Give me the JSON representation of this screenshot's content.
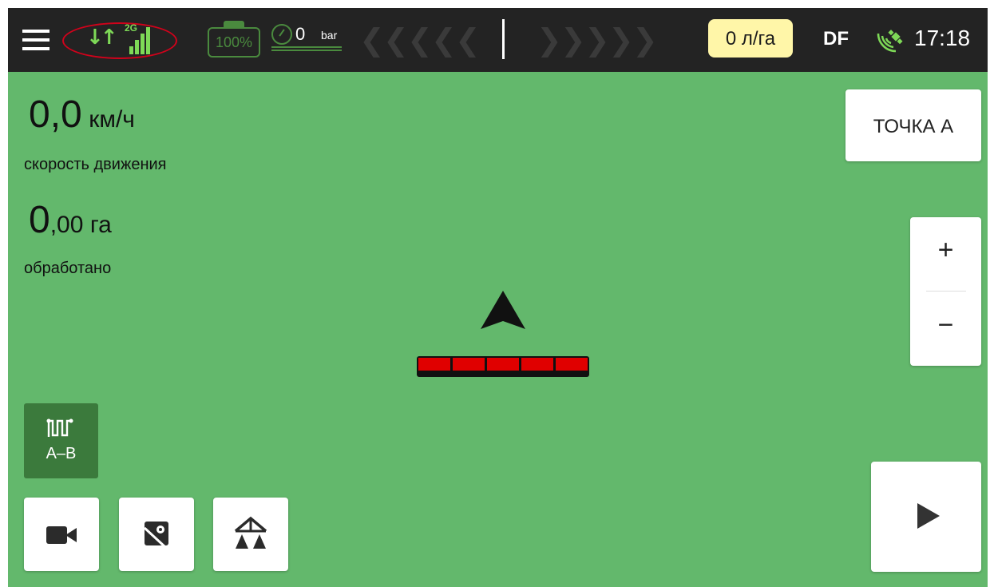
{
  "status": {
    "tank_percent": "100%",
    "pressure_value": "0",
    "pressure_unit": "bar",
    "rate": "0 л/га",
    "mode": "DF",
    "time": "17:18",
    "network_type": "2G"
  },
  "telemetry": {
    "speed_int": "0,0",
    "speed_unit": "км/ч",
    "speed_label": "скорость движения",
    "area_int": "0",
    "area_dec": ",00",
    "area_unit": "га",
    "area_label": "обработано"
  },
  "controls": {
    "point_a_label": "ТОЧКА А",
    "zoom_in": "+",
    "zoom_out": "−",
    "ab_mode_label": "A–B"
  },
  "colors": {
    "accent_green": "#63b86c",
    "rate_badge": "#fff6a8",
    "boom_section": "#e00000",
    "highlight_ring": "#d0021b"
  },
  "boom_sections": 5
}
